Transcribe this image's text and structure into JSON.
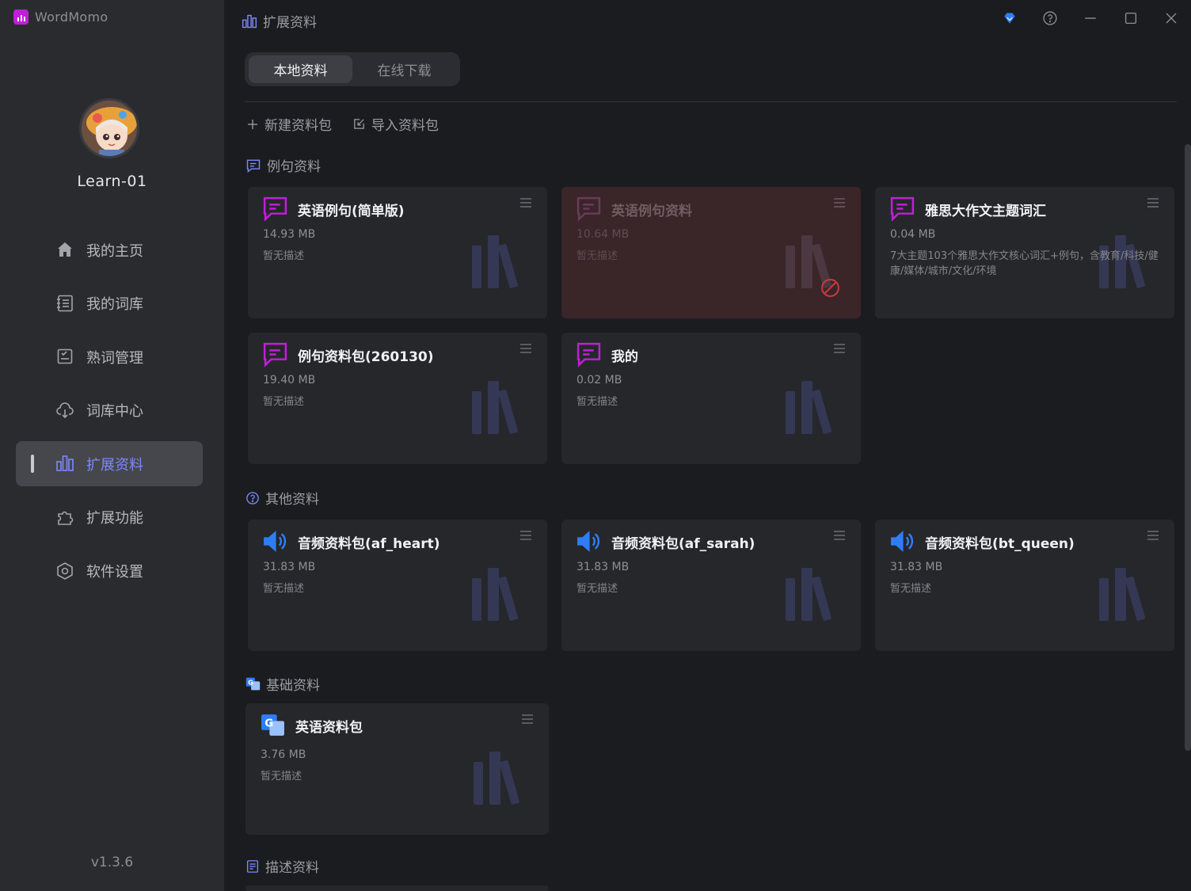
{
  "app": {
    "name": "WordMomo",
    "version": "v1.3.6"
  },
  "user": {
    "name": "Learn-01"
  },
  "nav": [
    {
      "label": "我的主页",
      "icon": "home-icon",
      "active": false
    },
    {
      "label": "我的词库",
      "icon": "book-icon",
      "active": false
    },
    {
      "label": "熟词管理",
      "icon": "checklist-icon",
      "active": false
    },
    {
      "label": "词库中心",
      "icon": "cloud-download-icon",
      "active": false
    },
    {
      "label": "扩展资料",
      "icon": "bar-chart-icon",
      "active": true
    },
    {
      "label": "扩展功能",
      "icon": "puzzle-icon",
      "active": false
    },
    {
      "label": "软件设置",
      "icon": "settings-hex-icon",
      "active": false
    }
  ],
  "header": {
    "title": "扩展资料"
  },
  "tabs": [
    {
      "label": "本地资料",
      "active": true
    },
    {
      "label": "在线下载",
      "active": false
    }
  ],
  "actions": {
    "new": "新建资料包",
    "import": "导入资料包"
  },
  "sections": [
    {
      "title": "例句资料",
      "icon": "chat-icon",
      "cards": [
        {
          "name": "英语例句(简单版)",
          "size": "14.93 MB",
          "desc": "暂无描述",
          "icon": "chat-bubble-icon",
          "disabled": false
        },
        {
          "name": "英语例句资料",
          "size": "10.64 MB",
          "desc": "暂无描述",
          "icon": "chat-bubble-icon",
          "disabled": true
        },
        {
          "name": "雅思大作文主题词汇",
          "size": "0.04 MB",
          "desc": "7大主题103个雅思大作文核心词汇+例句，含教育/科技/健康/媒体/城市/文化/环境",
          "icon": "chat-bubble-icon",
          "disabled": false
        },
        {
          "name": "例句资料包(260130)",
          "size": "19.40 MB",
          "desc": "暂无描述",
          "icon": "chat-bubble-icon",
          "disabled": false
        },
        {
          "name": "我的",
          "size": "0.02 MB",
          "desc": "暂无描述",
          "icon": "chat-bubble-icon",
          "disabled": false
        }
      ]
    },
    {
      "title": "其他资料",
      "icon": "question-circle-icon",
      "cards": [
        {
          "name": "音频资料包(af_heart)",
          "size": "31.83 MB",
          "desc": "暂无描述",
          "icon": "speaker-icon",
          "disabled": false
        },
        {
          "name": "音频资料包(af_sarah)",
          "size": "31.83 MB",
          "desc": "暂无描述",
          "icon": "speaker-icon",
          "disabled": false
        },
        {
          "name": "音频资料包(bt_queen)",
          "size": "31.83 MB",
          "desc": "暂无描述",
          "icon": "speaker-icon",
          "disabled": false
        }
      ]
    },
    {
      "title": "基础资料",
      "icon": "translate-icon",
      "cards": [
        {
          "name": "英语资料包",
          "size": "3.76 MB",
          "desc": "暂无描述",
          "icon": "translate-icon",
          "disabled": false
        }
      ]
    },
    {
      "title": "描述资料",
      "icon": "document-icon",
      "cards": []
    }
  ],
  "colors": {
    "accent": "#7d88ff",
    "chat": "#c01fd9",
    "audio": "#2f7df6",
    "disabled_card": "#3a2529"
  }
}
